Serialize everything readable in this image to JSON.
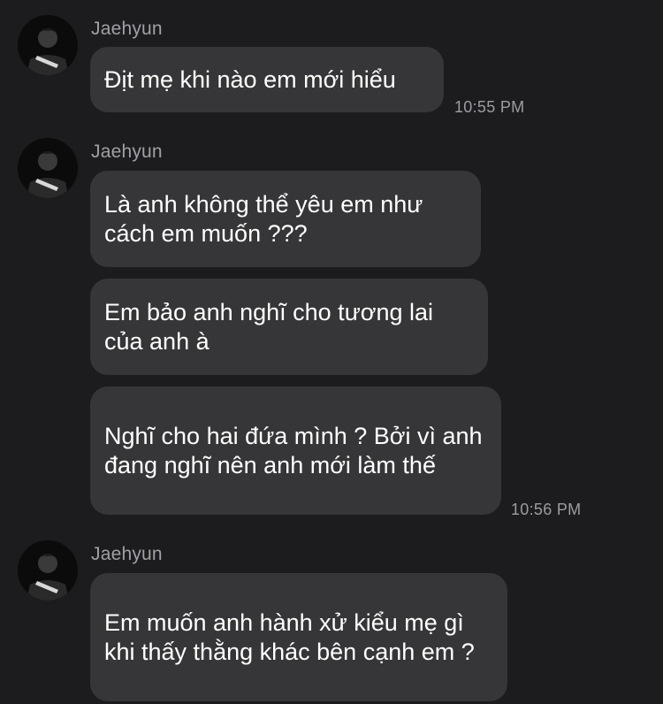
{
  "messages": [
    {
      "sender": "Jaehyun",
      "bubbles": [
        "Địt mẹ khi nào em mới hiểu"
      ],
      "time": "10:55 PM"
    },
    {
      "sender": "Jaehyun",
      "bubbles": [
        "Là anh không thể yêu em như cách em muốn ???",
        "Em bảo anh nghĩ cho tương lai của anh à",
        "Nghĩ cho hai đứa mình ? Bởi vì anh đang nghĩ nên anh mới làm thế"
      ],
      "time": "10:56 PM"
    },
    {
      "sender": "Jaehyun",
      "bubbles": [
        "Em muốn anh hành xử kiểu mẹ gì khi thấy thằng khác bên cạnh em ?"
      ]
    }
  ],
  "colors": {
    "background": "#1c1c1e",
    "bubble": "#363638",
    "sender_name": "#a0a0a5",
    "timestamp": "#9c9ca1"
  },
  "icons": {
    "avatar": "profile-photo-avatar"
  }
}
